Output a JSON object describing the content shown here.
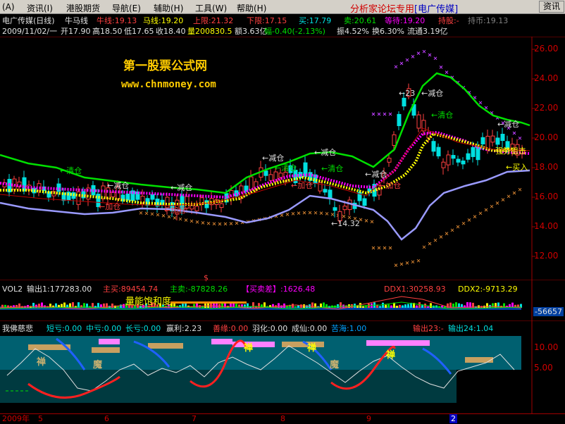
{
  "menu": {
    "items": [
      "(A)",
      "资讯(I)",
      "港股期货",
      "导航(E)",
      "辅助(H)",
      "工具(W)",
      "帮助(H)"
    ],
    "brand": "分析家论坛专用",
    "brand_name": "[电广传媒]",
    "quote_button": "资讯"
  },
  "header": {
    "title": "电广传媒(日线)",
    "indicator": "牛马线",
    "niu": "牛线:19.13",
    "ma": "马线:19.20",
    "upper": "上限:21.32",
    "lower": "下限:17.15",
    "buy": "买:17.79",
    "sell": "卖:20.61",
    "wait": "等待:19.20",
    "hold": "持股:-",
    "holdcash": "持币:19.13"
  },
  "quote": {
    "date": "2009/11/02/一",
    "open": "开17.90",
    "high": "高18.50",
    "low": "低17.65",
    "close": "收18.40",
    "volume": "量200830.5",
    "amount": "额3.63亿",
    "change": "幅-0.40(-2.13%)",
    "amplitude": "振4.52%",
    "turnover": "换6.30%",
    "float": "流通3.19亿"
  },
  "watermark": {
    "line1": "第一股票公式网",
    "line2": "www.chnmoney.com"
  },
  "main_chart": {
    "price_ticks": [
      "26.00",
      "24.00",
      "22.00",
      "20.00",
      "18.00",
      "16.00",
      "14.00",
      "12.00"
    ],
    "annotations": {
      "jiancang": "减仓",
      "qingcang": "清仓",
      "jiacang": "加仓",
      "maixian": "买入",
      "zhuiji": "强势狙击",
      "low_mark": "14.32",
      "high_mark": "23",
      "dollar": "$"
    },
    "colors": {
      "upper": "#00e000",
      "lower": "#9a9aff",
      "niu": "#ff00ff",
      "ma": "#ffff00",
      "up": "#ff4040",
      "down": "#00e0e0"
    }
  },
  "vol_panel": {
    "name": "VOL2",
    "out1": "输出1:177283.00",
    "main_buy": "主买:89454.74",
    "main_sell": "主卖:-87828.26",
    "diff": "【买卖差】:1626.48",
    "ddx1": "DDX1:30258.93",
    "ddx2": "DDX2:-9713.29",
    "saturation": "量能饱和度",
    "axis_value": "-56657"
  },
  "buddha_panel": {
    "name": "我佛慈悲",
    "duanqi": "短亏:0.00",
    "zhongqi": "中亏:0.00",
    "changqi": "长亏:0.00",
    "yingli": "赢利:2.23",
    "shanyuan": "善缘:0.00",
    "yuhua": "羽化:0.00",
    "chengxian": "成仙:0.00",
    "kuhai": "苦海:1.00",
    "out23": "输出23:-",
    "out24": "输出24:1.04",
    "axis_value": "10.00",
    "axis_value2": "5.00",
    "marks": {
      "chan": "禅",
      "mo": "魔"
    }
  },
  "date_axis": {
    "year": "2009年",
    "months": [
      "5",
      "6",
      "7",
      "8",
      "9",
      "2"
    ]
  }
}
